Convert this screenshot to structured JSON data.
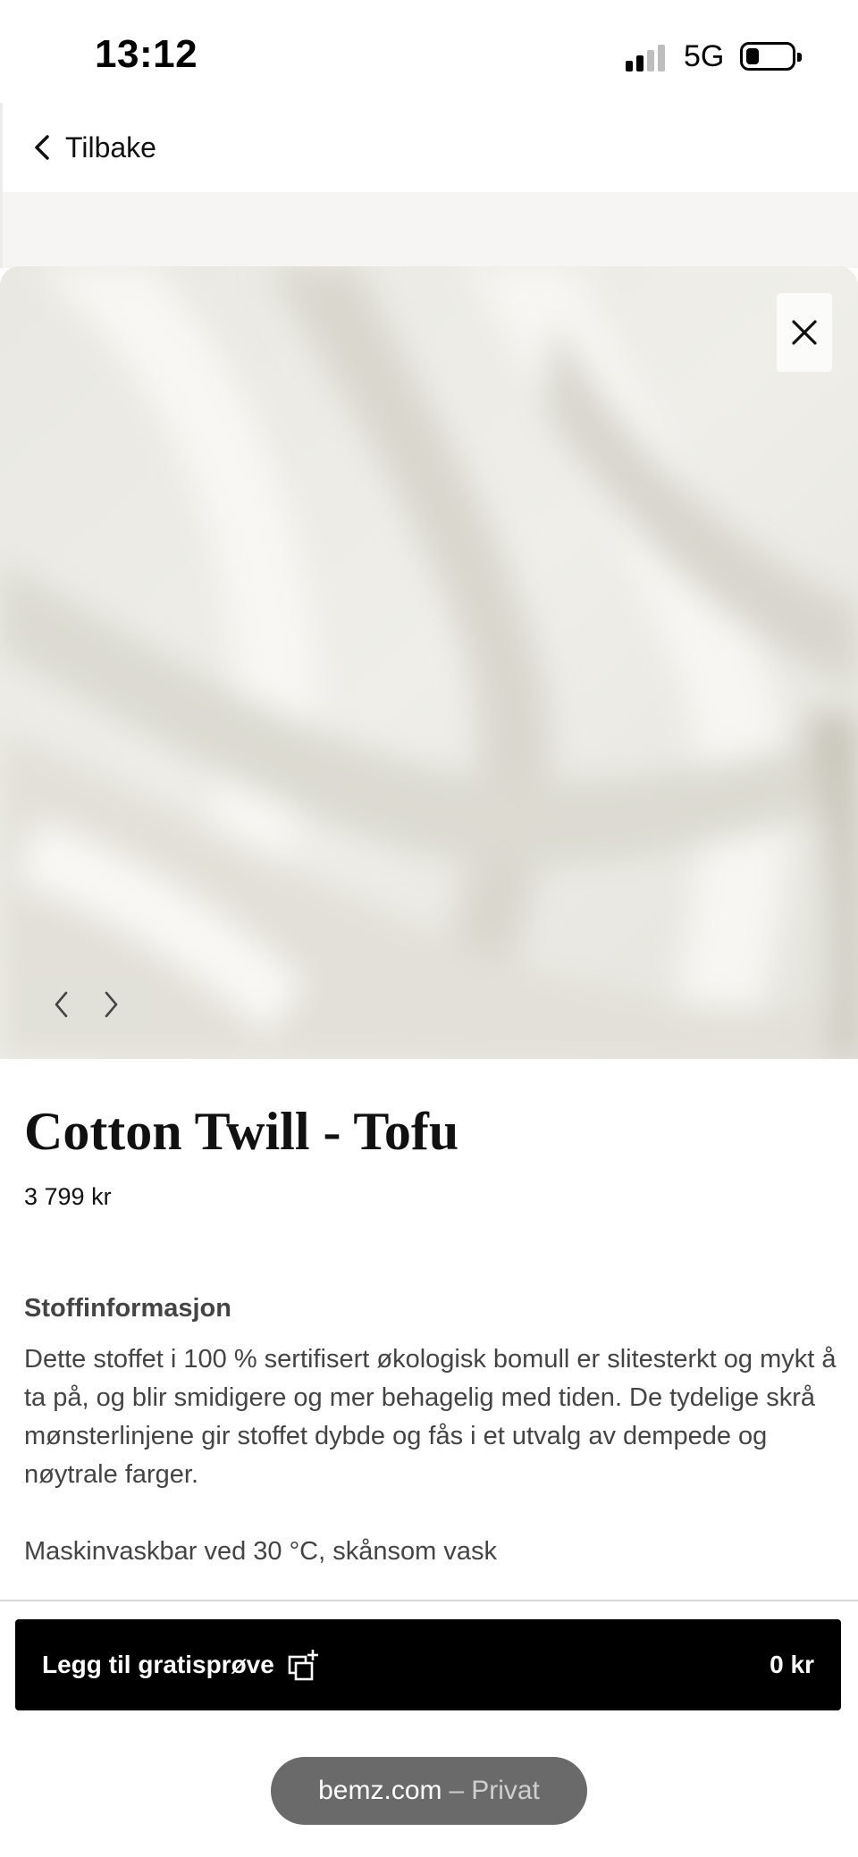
{
  "status_bar": {
    "time": "13:12",
    "network": "5G"
  },
  "nav": {
    "back_label": "Tilbake",
    "back_icon": "chevron-left-icon"
  },
  "gallery": {
    "image_alt": "cream fabric drape",
    "close_icon": "close-icon",
    "prev_icon": "chevron-left-icon",
    "next_icon": "chevron-right-icon"
  },
  "product": {
    "title": "Cotton Twill - Tofu",
    "price": "3 799 kr"
  },
  "fabric_info": {
    "heading": "Stoffinformasjon",
    "description": "Dette stoffet i 100 % sertifisert økologisk bomull er slitesterkt og mykt å ta på, og blir smidigere og mer behagelig med tiden. De tydelige skrå mønsterlinjene gir stoffet dybde og fås i et utvalg av dempede og nøytrale farger.",
    "care": "Maskinvaskbar ved 30 °C, skånsom vask"
  },
  "cta": {
    "label": "Legg til gratisprøve",
    "icon": "add-sample-icon",
    "price": "0 kr"
  },
  "browser": {
    "domain": "bemz.com",
    "separator": "–",
    "mode": "Privat"
  },
  "colors": {
    "cta_background": "#000000",
    "fabric": "#ecebe5",
    "url_pill": "#6a6a6a"
  }
}
